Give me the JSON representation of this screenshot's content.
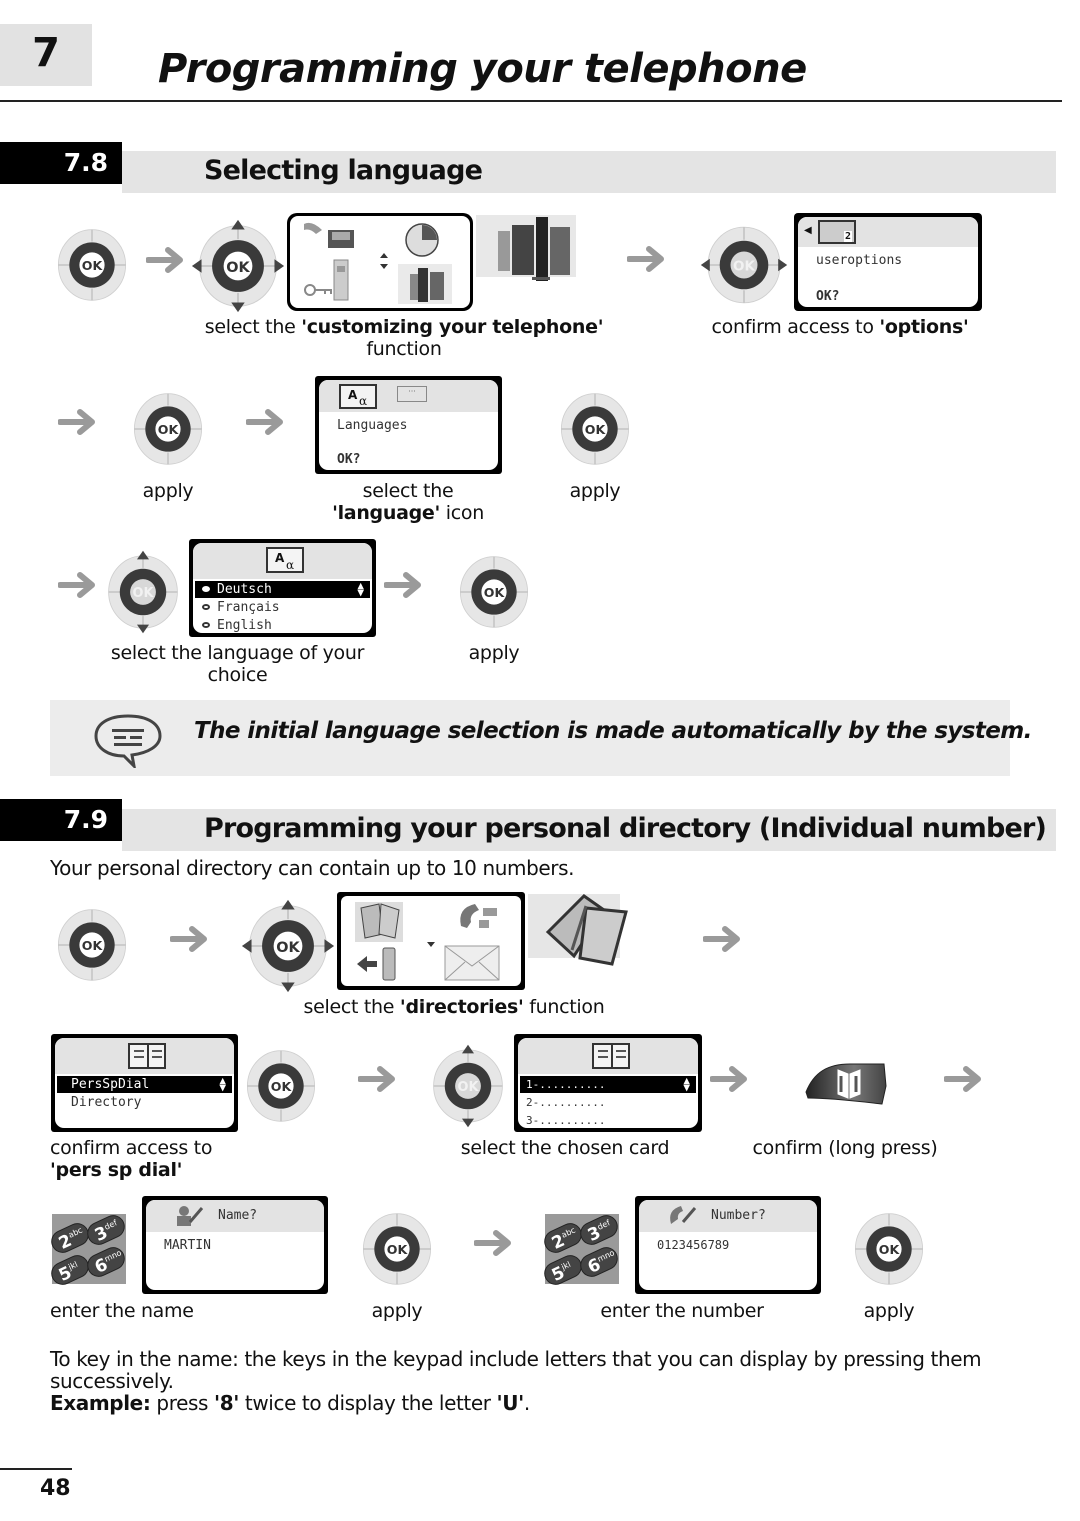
{
  "chapter": {
    "number": "7",
    "title": "Programming your telephone"
  },
  "section_78": {
    "number": "7.8",
    "title": "Selecting language",
    "step1_caption_pre": "select the ",
    "step1_caption_bold": "'customizing your telephone'",
    "step1_caption_post": "function",
    "step2_caption_pre": "confirm access to ",
    "step2_caption_bold": "'options'",
    "options_screen": {
      "line1": "useroptions",
      "prompt": "OK?"
    },
    "apply_1": "apply",
    "language_icon_caption_pre": "select the",
    "language_icon_caption_bold": "'language'",
    "language_icon_caption_post": " icon",
    "languages_screen": {
      "line1": "Languages",
      "prompt": "OK?"
    },
    "apply_2": "apply",
    "language_list": [
      "Deutsch",
      "Français",
      "English"
    ],
    "selected_language": "Deutsch",
    "select_language_caption_1": "select the language of your",
    "select_language_caption_2": "choice",
    "apply_3": "apply"
  },
  "note": {
    "icon": "speech-bubble-icon",
    "text": "The initial language selection is made automatically by the system."
  },
  "section_79": {
    "number": "7.9",
    "title": "Programming your personal directory  (Individual number)",
    "intro": "Your personal directory can contain up to 10 numbers.",
    "directories_caption_pre": "select the ",
    "directories_caption_bold": "'directories'",
    "directories_caption_post": " function",
    "dir_screen": {
      "items": [
        "PersSpDial",
        "Directory"
      ]
    },
    "pers_caption_1": "confirm access to",
    "pers_caption_2": "'pers sp dial'",
    "card_screen": {
      "items": [
        "1-..........",
        "2-..........",
        "3-.........."
      ]
    },
    "card_caption": "select the chosen card",
    "long_press_caption": "confirm (long press)",
    "name_screen": {
      "title": "Name?",
      "value": "MARTIN"
    },
    "enter_name_caption": "enter the name",
    "apply_4": "apply",
    "number_screen": {
      "title": "Number?",
      "value": "0123456789"
    },
    "enter_number_caption": "enter the number",
    "apply_5": "apply",
    "keypad_keys": [
      {
        "digit": "2",
        "letters": "abc"
      },
      {
        "digit": "3",
        "letters": "def"
      },
      {
        "digit": "5",
        "letters": "jkl"
      },
      {
        "digit": "6",
        "letters": "mno"
      }
    ],
    "tip_line1": "To key in the name: the keys in the keypad include letters that you can display by pressing them",
    "tip_line2": "successively.",
    "example_label": "Example:",
    "example_pre": " press ",
    "example_key": "'8'",
    "example_mid": " twice to display the letter ",
    "example_letter": "'U'",
    "example_post": "."
  },
  "ok_label": "OK",
  "page_number": "48",
  "colors": {
    "dark_ring": "#3a3a3a",
    "light_ring": "#e6e6e6",
    "arrow": "#9a9a9a",
    "section_bar": "#e4e4e4",
    "note_bg": "#ececec"
  }
}
